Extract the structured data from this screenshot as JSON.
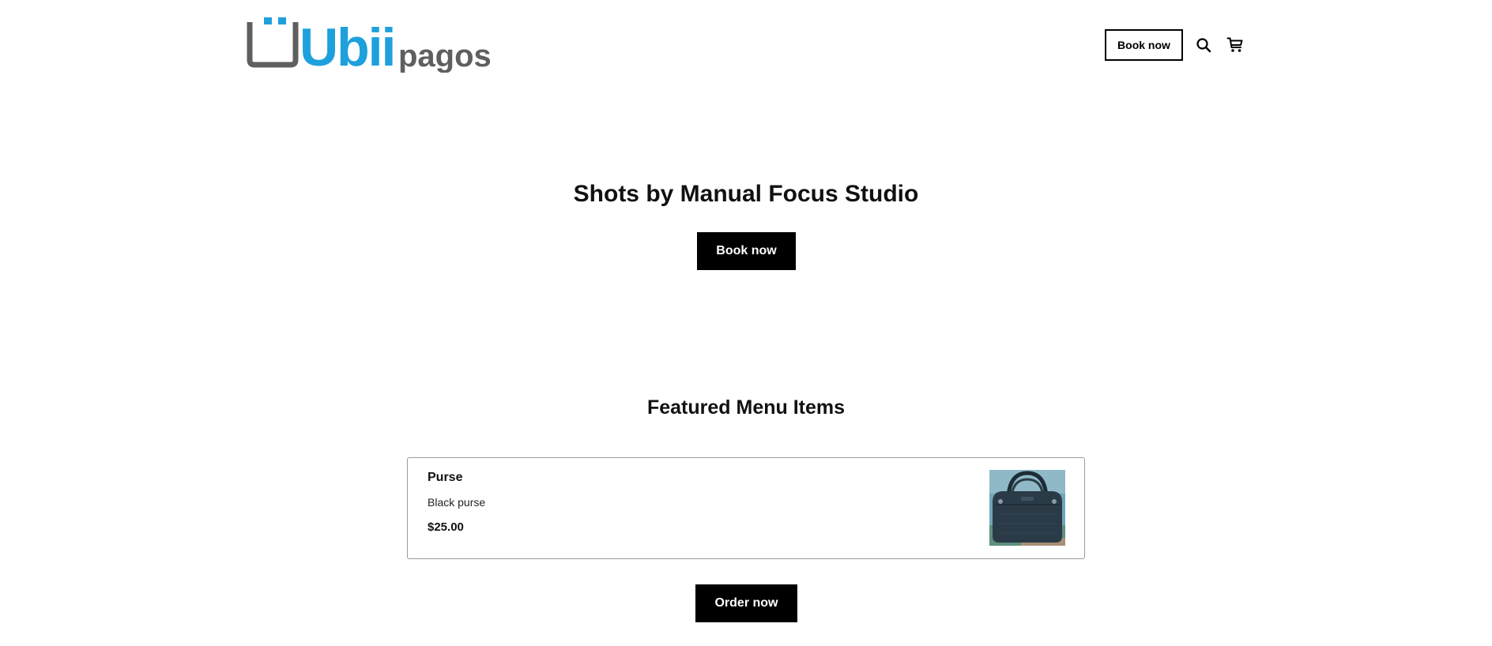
{
  "header": {
    "logo": {
      "text_primary": "Ubii",
      "text_secondary": "pagos",
      "alt": "Ubii pagos logo"
    },
    "book_label": "Book now",
    "icons": {
      "search": "search-icon",
      "cart": "cart-icon"
    }
  },
  "hero": {
    "title": "Shots by Manual Focus Studio",
    "button_label": "Book now"
  },
  "featured": {
    "title": "Featured Menu Items",
    "items": [
      {
        "name": "Purse",
        "description": "Black purse",
        "price": "$25.00",
        "image_icon": "purse-photo"
      }
    ],
    "order_label": "Order now"
  },
  "colors": {
    "brand_blue": "#1ea0dc",
    "brand_gray": "#5f5f5f",
    "button_black": "#000000",
    "card_border": "#9a9a9a"
  }
}
